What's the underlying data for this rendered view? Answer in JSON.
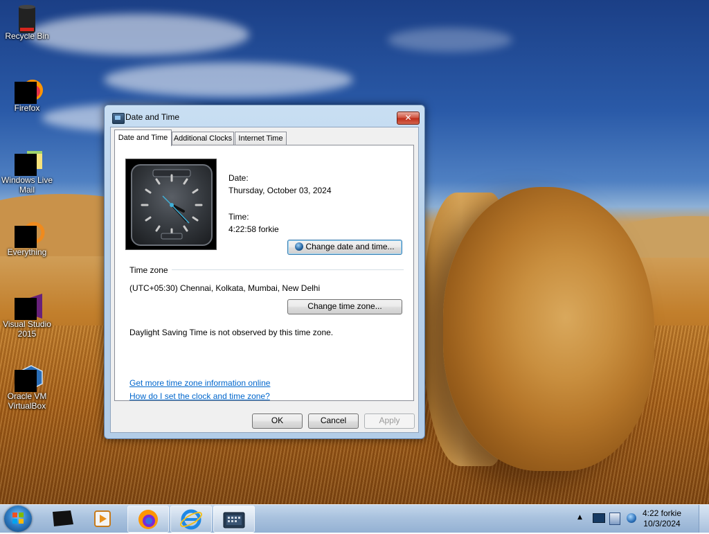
{
  "desktop": {
    "icons": [
      {
        "label": "Recycle Bin",
        "icon": "recycle-bin-icon"
      },
      {
        "label": "Firefox",
        "icon": "firefox-icon"
      },
      {
        "label": "Windows Live Mail",
        "icon": "windows-live-mail-icon"
      },
      {
        "label": "Everything",
        "icon": "everything-icon"
      },
      {
        "label": "Visual Studio 2015",
        "icon": "visual-studio-icon"
      },
      {
        "label": "Oracle VM VirtualBox",
        "icon": "virtualbox-icon"
      }
    ]
  },
  "dialog": {
    "title": "Date and Time",
    "close_label": "✕",
    "tabs": [
      {
        "label": "Date and Time",
        "active": true
      },
      {
        "label": "Additional Clocks",
        "active": false
      },
      {
        "label": "Internet Time",
        "active": false
      }
    ],
    "date_label": "Date:",
    "date_value": "Thursday, October 03, 2024",
    "time_label": "Time:",
    "time_value": "4:22:58 forkie",
    "change_datetime_button": "Change date and time...",
    "timezone_heading": "Time zone",
    "timezone_value": "(UTC+05:30) Chennai, Kolkata, Mumbai, New Delhi",
    "change_timezone_button": "Change time zone...",
    "dst_note": "Daylight Saving Time is not observed by this time zone.",
    "link_more_info": "Get more time zone information online",
    "link_how_to": "How do I set the clock and time zone?",
    "ok_button": "OK",
    "cancel_button": "Cancel",
    "apply_button": "Apply"
  },
  "taskbar": {
    "pinned": [
      "media-player-icon",
      "firefox-icon",
      "internet-explorer-icon",
      "date-time-window-icon"
    ],
    "tray_time": "4:22 forkie",
    "tray_date": "10/3/2024",
    "colors": {
      "accent": "#3c7fb1",
      "link": "#0066cc",
      "close": "#c63a25"
    }
  }
}
